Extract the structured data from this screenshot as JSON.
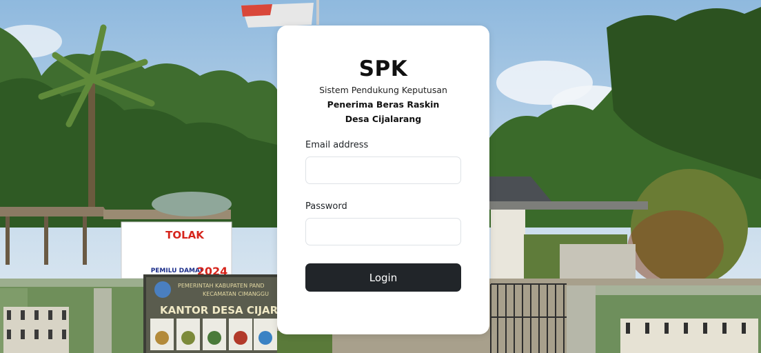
{
  "card": {
    "title": "SPK",
    "subtitle": "Sistem Pendukung Keputusan",
    "line2": "Penerima Beras Raskin",
    "line3": "Desa Cijalarang"
  },
  "form": {
    "email_label": "Email address",
    "email_value": "",
    "password_label": "Password",
    "password_value": "",
    "login_label": "Login"
  },
  "background": {
    "banner_text": "TOLAK",
    "banner_sub": "PEMILU DAMAI",
    "banner_year": "2024",
    "sign_line1": "PEMERINTAH KABUPATEN PAND",
    "sign_line2": "KECAMATAN CIMANGGU",
    "sign_line3": "KANTOR DESA CIJAR"
  },
  "colors": {
    "button": "#212529",
    "card": "#ffffff",
    "sky": "#b9d3ea"
  }
}
